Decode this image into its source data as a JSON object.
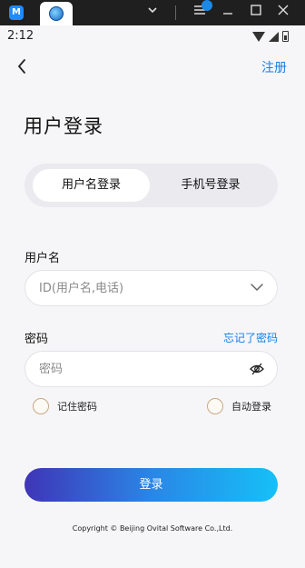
{
  "emulator": {
    "app_icon": "M",
    "tab_icon": "browser-globe-icon",
    "controls": [
      "chevron-down-icon",
      "menu-icon",
      "minimize-icon",
      "maximize-icon",
      "close-icon"
    ]
  },
  "status_bar": {
    "time": "2:12",
    "icons": [
      "wifi-icon",
      "signal-icon",
      "battery-icon"
    ]
  },
  "header": {
    "back_icon": "chevron-left-icon",
    "register_label": "注册",
    "title": "用户登录"
  },
  "tabs": [
    {
      "label": "用户名登录",
      "active": true
    },
    {
      "label": "手机号登录",
      "active": false
    }
  ],
  "username": {
    "label": "用户名",
    "placeholder": "ID(用户名,电话)",
    "value": ""
  },
  "password": {
    "label": "密码",
    "forgot_label": "忘记了密码",
    "placeholder": "密码",
    "value": ""
  },
  "options": {
    "remember": {
      "label": "记住密码",
      "checked": false
    },
    "auto_login": {
      "label": "自动登录",
      "checked": false
    }
  },
  "login_button": {
    "label": "登录"
  },
  "footer": {
    "copyright": "Copyright © Beijing Ovital Software Co.,Ltd."
  },
  "colors": {
    "accent": "#1a7fe0",
    "button_gradient_start": "#3f35b7",
    "button_gradient_end": "#16c0f7",
    "background": "#f6f6f8"
  }
}
